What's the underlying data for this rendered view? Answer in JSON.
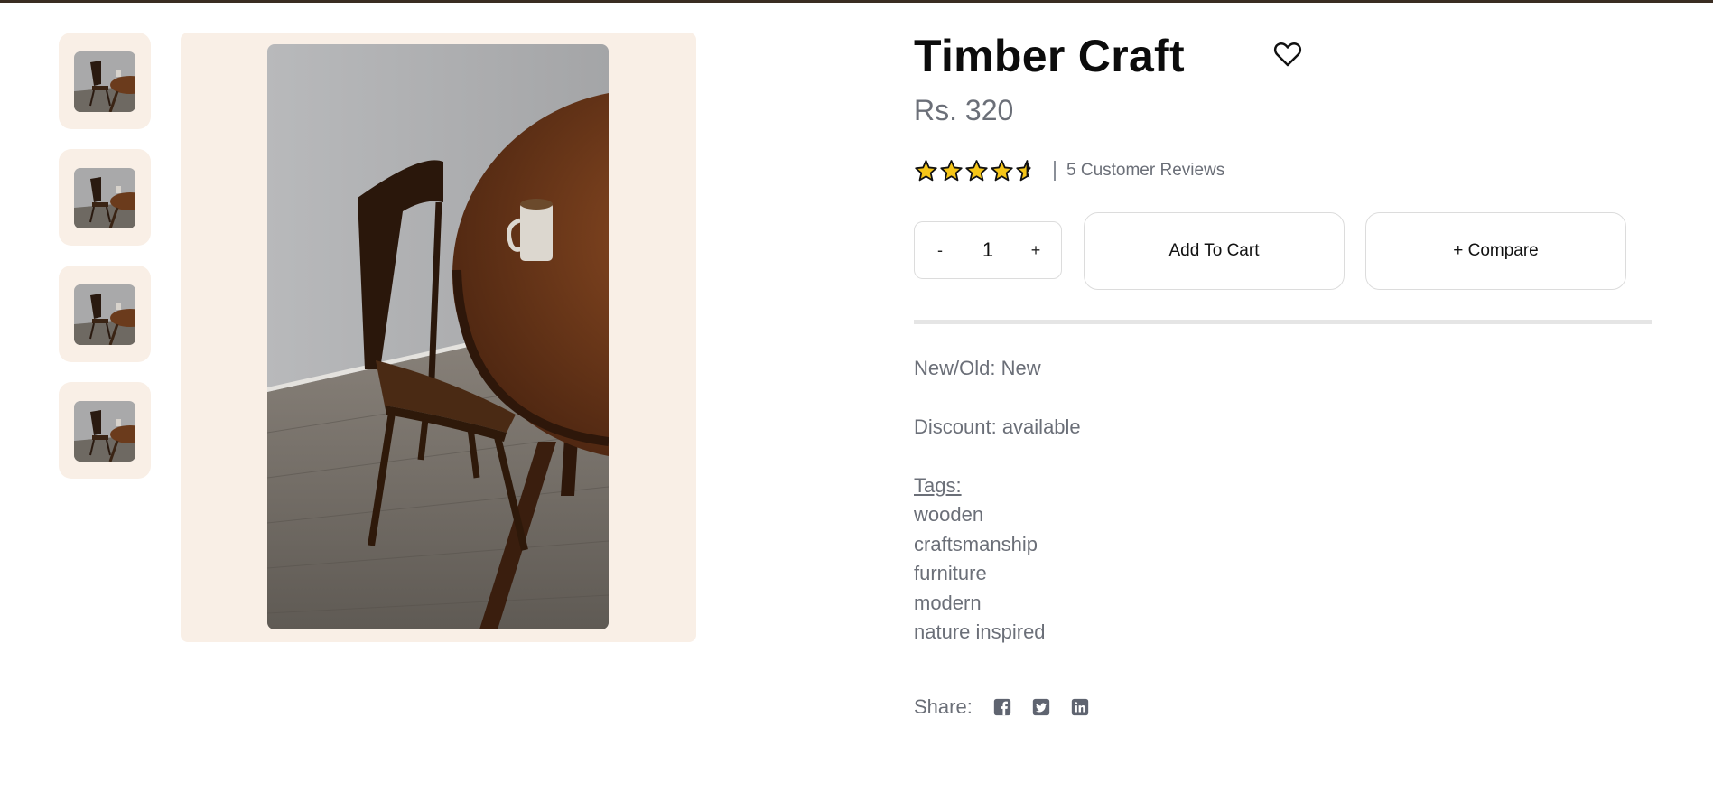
{
  "product": {
    "title": "Timber Craft",
    "price": "Rs. 320",
    "rating": 4.5,
    "reviews_text": "5 Customer Reviews",
    "quantity": "1",
    "qty_minus": "-",
    "qty_plus": "+",
    "add_to_cart": "Add To Cart",
    "compare": "+ Compare",
    "condition": "New/Old: New",
    "discount": "Discount: available",
    "tags_label": "Tags:",
    "tags": [
      "wooden",
      "craftsmanship",
      "furniture",
      "modern",
      "nature inspired"
    ],
    "share_label": "Share:"
  },
  "icons": {
    "favorite": "heart-icon",
    "share": [
      "facebook-icon",
      "twitter-icon",
      "linkedin-icon"
    ]
  },
  "colors": {
    "accent_bg": "#f9efe6",
    "star": "#f5c518",
    "muted_text": "#6b6f78",
    "top_bar": "#3a2d22"
  }
}
